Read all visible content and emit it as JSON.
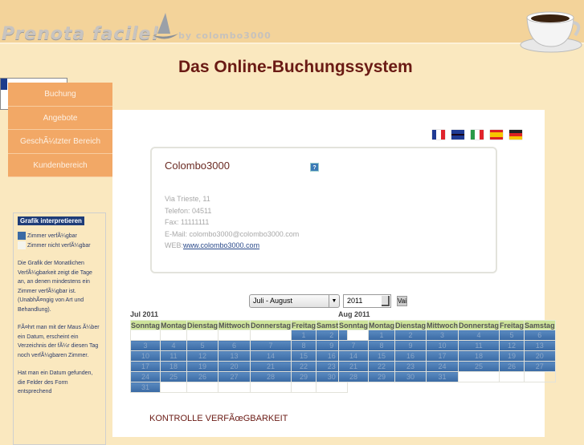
{
  "header": {
    "logo": "Prenota facile!",
    "by": "by colombo3000",
    "title": "Das Online-Buchungssystem"
  },
  "menu": [
    {
      "label": "Buchung"
    },
    {
      "label": "Angebote"
    },
    {
      "label": "GeschÃ¼tzter Bereich"
    },
    {
      "label": "Kundenbereich"
    }
  ],
  "legend": {
    "title": "Grafik interpretieren",
    "available": "Zimmer verfÃ¼gbar",
    "unavailable": "Zimmer nicht verfÃ¼gbar",
    "p1": "Die Grafik der Monatlichen VerfÃ¼gbarkeit zeigt die Tage an, an denen mindestens ein Zimmer verfÃ¼gbar ist. (UnabhÃ¤ngig von Art und Behandlung).",
    "p2": "FÃ¤hrt man mit der Maus Ã¼ber ein Datum, erscheint ein Verzeichnis der fÃ¼r diesen Tag noch verfÃ¼gbaren Zimmer.",
    "p3": "Hat man ein Datum gefunden, die Felder des Form entsprechend",
    "colors": {
      "available": "#3a6aa4",
      "unavailable": "#f4f4ec"
    }
  },
  "flags": [
    "fr",
    "gb",
    "it",
    "es",
    "de"
  ],
  "card": {
    "name": "Colombo3000",
    "help": "?",
    "address": "Via Trieste, 11",
    "phone": "Telefon: 04511",
    "fax": "Fax: 11111111",
    "email": "E-Mail: colombo3000@colombo3000.com",
    "web_label": "WEB:",
    "web_link": "www.colombo3000.com"
  },
  "controls": {
    "period": "Juli - August",
    "year": "2011",
    "go": "Vai"
  },
  "weekdays": [
    "Sonntag",
    "Montag",
    "Dienstag",
    "Mittwoch",
    "Donnerstag",
    "Freitag",
    "Samstag"
  ],
  "calendars": [
    {
      "title": "Jul 2011",
      "offset": 5,
      "days": 31
    },
    {
      "title": "Aug 2011",
      "offset": 1,
      "days": 31
    }
  ],
  "availability_title": "KONTROLLE VERFÃœGBARKEIT"
}
